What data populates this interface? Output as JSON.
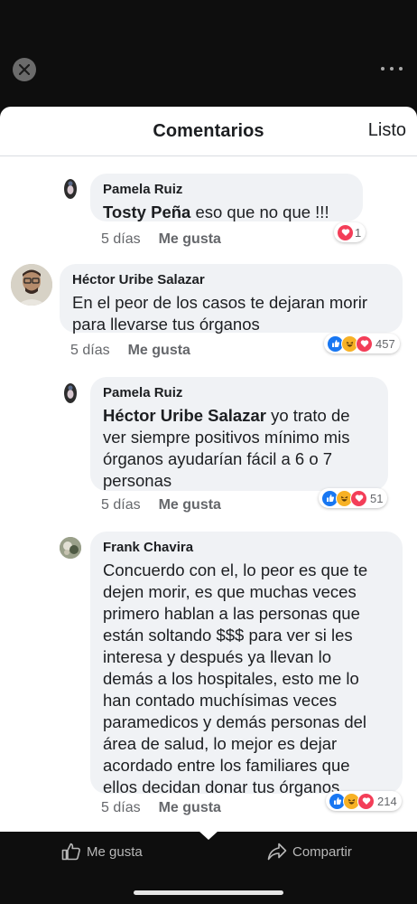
{
  "header": {
    "title": "Comentarios",
    "done_label": "Listo"
  },
  "comments": [
    {
      "author": "Pamela Ruiz",
      "mention": "Tosty Peña",
      "text_lines": [
        "eso que no que !!!"
      ],
      "time": "5 días",
      "like_label": "Me gusta",
      "reaction_count": "1"
    },
    {
      "author": "Héctor Uribe Salazar",
      "mention": "",
      "text_lines": [
        "En el peor de los casos te dejaran morir",
        "para llevarse tus órganos"
      ],
      "time": "5 días",
      "like_label": "Me gusta",
      "reaction_count": "457"
    },
    {
      "author": "Pamela Ruiz",
      "mention": "Héctor Uribe Salazar",
      "text_lines": [
        "yo trato de",
        "ver siempre  positivos mínimo mis",
        "órganos ayudarían fácil a 6 o 7",
        "personas"
      ],
      "time": "5 días",
      "like_label": "Me gusta",
      "reaction_count": "51"
    },
    {
      "author": "Frank Chavira",
      "mention": "",
      "text_lines": [
        "Concuerdo con el, lo peor es que te",
        "dejen morir, es que muchas veces",
        "primero hablan a las personas que",
        "están soltando $$$ para ver si les",
        "interesa y después ya llevan lo",
        "demás a los hospitales, esto me lo",
        "han contado muchísimas veces",
        "paramedicos y demás personas del",
        "área de salud, lo mejor es dejar",
        "acordado entre los familiares que",
        "ellos decidan donar tus órganos"
      ],
      "time": "5 días",
      "like_label": "Me gusta",
      "reaction_count": "214"
    }
  ],
  "bottom_bar": {
    "like_label": "Me gusta",
    "share_label": "Compartir"
  },
  "colors": {
    "like": "#1877f2",
    "love": "#f33e58",
    "haha": "#f7b125",
    "bubble": "#f0f2f5"
  }
}
